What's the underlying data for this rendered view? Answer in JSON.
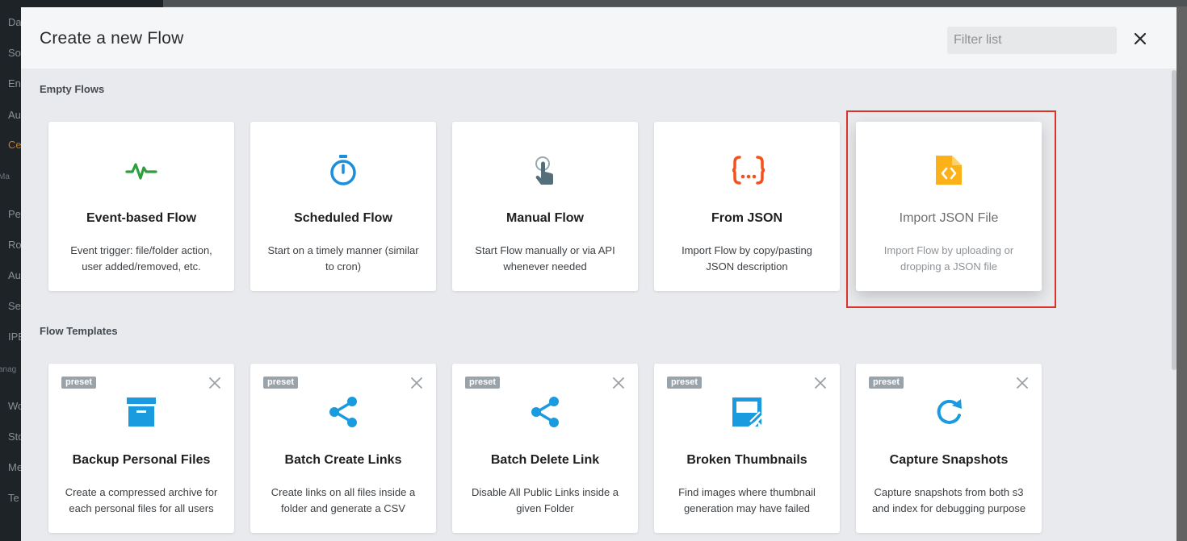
{
  "background_app": {
    "sidebar_items": [
      {
        "label": "Da",
        "kind": "item"
      },
      {
        "label": "So",
        "kind": "item"
      },
      {
        "label": "En",
        "kind": "item"
      },
      {
        "label": "Au",
        "kind": "item"
      },
      {
        "label": "Ce",
        "kind": "active"
      },
      {
        "label": "Ma",
        "kind": "section"
      },
      {
        "label": "Pe",
        "kind": "item"
      },
      {
        "label": "Ro",
        "kind": "item"
      },
      {
        "label": "Au",
        "kind": "item"
      },
      {
        "label": "Se",
        "kind": "item"
      },
      {
        "label": "IPE",
        "kind": "item"
      },
      {
        "label": "anag",
        "kind": "section"
      },
      {
        "label": "Wo",
        "kind": "item"
      },
      {
        "label": "Sto",
        "kind": "item"
      },
      {
        "label": "Me",
        "kind": "item"
      },
      {
        "label": "Te",
        "kind": "item"
      }
    ]
  },
  "modal": {
    "title": "Create a new Flow",
    "filter_placeholder": "Filter list",
    "close_icon": "close-icon",
    "sections": {
      "empty_flows": "Empty Flows",
      "flow_templates": "Flow Templates"
    },
    "empty_flows": [
      {
        "title": "Event-based Flow",
        "desc": "Event trigger: file/folder action, user added/removed, etc.",
        "icon": "activity-pulse-icon",
        "color": "#2e9e3e"
      },
      {
        "title": "Scheduled Flow",
        "desc": "Start on a timely manner (similar to cron)",
        "icon": "stopwatch-icon",
        "color": "#1a8fdd"
      },
      {
        "title": "Manual Flow",
        "desc": "Start Flow manually or via API whenever needed",
        "icon": "touch-hand-icon",
        "color": "#546e7a"
      },
      {
        "title": "From JSON",
        "desc": "Import Flow by copy/pasting JSON description",
        "icon": "json-braces-icon",
        "color": "#f4511e"
      },
      {
        "title": "Import JSON File",
        "desc": "Import Flow by uploading or dropping a JSON file",
        "icon": "code-file-icon",
        "color": "#fbb117"
      }
    ],
    "templates": [
      {
        "badge": "preset",
        "title": "Backup Personal Files",
        "desc": "Create a compressed archive for each personal files for all users",
        "icon": "archive-box-icon",
        "color": "#1a9be0"
      },
      {
        "badge": "preset",
        "title": "Batch Create Links",
        "desc": "Create links on all files inside a folder and generate a CSV",
        "icon": "share-icon",
        "color": "#1a9be0"
      },
      {
        "badge": "preset",
        "title": "Batch Delete Link",
        "desc": "Disable All Public Links inside a given Folder",
        "icon": "share-icon",
        "color": "#1a9be0"
      },
      {
        "badge": "preset",
        "title": "Broken Thumbnails",
        "desc": "Find images where thumbnail generation may have failed",
        "icon": "broken-image-icon",
        "color": "#1a9be0"
      },
      {
        "badge": "preset",
        "title": "Capture Snapshots",
        "desc": "Capture snapshots from both s3 and index for debugging purpose",
        "icon": "refresh-icon",
        "color": "#1a9be0"
      }
    ],
    "highlighted_card": "Import JSON File"
  }
}
